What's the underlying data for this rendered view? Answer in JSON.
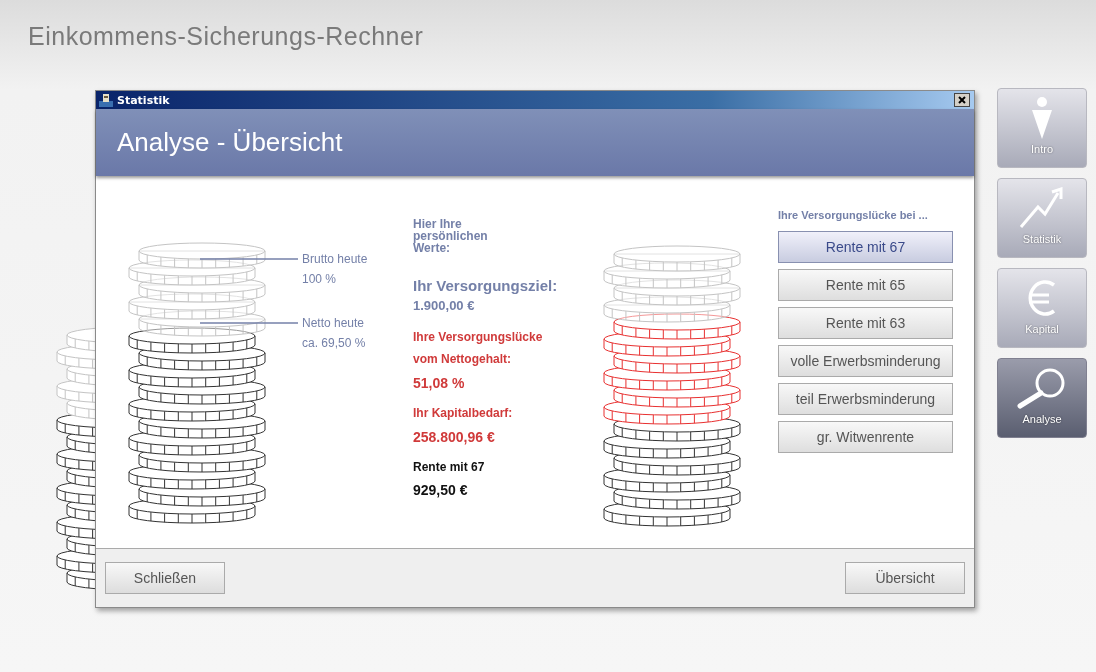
{
  "app_title": "Einkommens-Sicherungs-Rechner",
  "dialog": {
    "title": "Statistik",
    "heading": "Analyse - Übersicht",
    "stack_labels": [
      {
        "label": "Brutto heute",
        "value": "100 %"
      },
      {
        "label": "Netto heute",
        "value": "ca. 69,50 %"
      }
    ],
    "values": [
      {
        "kind": "note",
        "text": "Hier Ihre persönlichen Werte:"
      },
      {
        "kind": "goal-label",
        "text": "Ihr Versorgungsziel:"
      },
      {
        "kind": "goal-value",
        "text": "1.900,00 €"
      },
      {
        "kind": "gap-label",
        "text": "Ihre Versorgungslücke"
      },
      {
        "kind": "gap-label",
        "text": "vom Nettogehalt:"
      },
      {
        "kind": "gap-value",
        "text": "51,08 %"
      },
      {
        "kind": "gap-label",
        "text": "Ihr Kapitalbedarf:"
      },
      {
        "kind": "gap-value",
        "text": "258.800,96 €"
      },
      {
        "kind": "pension-label",
        "text": "Rente mit 67"
      },
      {
        "kind": "pension-value",
        "text": "929,50 €"
      }
    ],
    "options_title": "Ihre Versorgungslücke bei ...",
    "options": [
      {
        "label": "Rente mit 67",
        "selected": true
      },
      {
        "label": "Rente mit 65",
        "selected": false
      },
      {
        "label": "Rente mit 63",
        "selected": false
      },
      {
        "label": "volle Erwerbsminderung",
        "selected": false
      },
      {
        "label": "teil Erwerbsminderung",
        "selected": false
      },
      {
        "label": "gr. Witwenrente",
        "selected": false
      }
    ],
    "footer_buttons": [
      "Schließen",
      "Übersicht"
    ]
  },
  "nav": [
    {
      "label": "Intro",
      "selected": false
    },
    {
      "label": "Statistik",
      "selected": false
    },
    {
      "label": "Kapital",
      "selected": false
    },
    {
      "label": "Analyse",
      "selected": true
    }
  ]
}
